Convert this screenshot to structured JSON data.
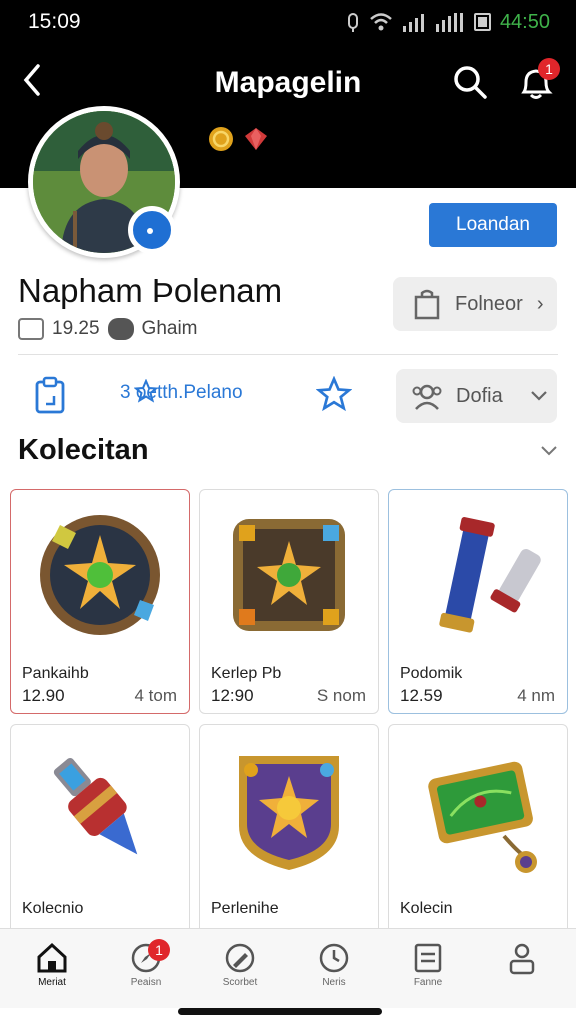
{
  "status": {
    "time": "15:09",
    "battery": "44:50"
  },
  "header": {
    "title": "Mapagelin",
    "glyph": " ",
    "notif_count": "1"
  },
  "profile": {
    "name": "Napham Þolenam",
    "stat_value": "19.25",
    "stat_label": "Ghaim",
    "primary_button": "Loandan",
    "follow_button": "Folneor"
  },
  "actions": {
    "middle_label": "3 oetth.Pelano",
    "dropdown_label": "Dofia"
  },
  "collection": {
    "title": "Kolecitan"
  },
  "cards": [
    {
      "name": "Pankaihb",
      "price": "12.90",
      "qty": "4 tom"
    },
    {
      "name": "Kerlep Pb",
      "price": "12:90",
      "qty": "S nom"
    },
    {
      "name": "Podomik",
      "price": "12.59",
      "qty": "4 nm"
    },
    {
      "name": "Kolecnio",
      "price": "",
      "qty": ""
    },
    {
      "name": "Perlenihe",
      "price": "",
      "qty": ""
    },
    {
      "name": "Kolecin",
      "price": "",
      "qty": ""
    }
  ],
  "nav": [
    {
      "label": "Meriat",
      "icon": "home-icon"
    },
    {
      "label": "Peaisn",
      "icon": "explore-icon"
    },
    {
      "label": "Scorbet",
      "icon": "edit-icon"
    },
    {
      "label": "Neris",
      "icon": "refresh-icon"
    },
    {
      "label": "Fanne",
      "icon": "list-icon"
    },
    {
      "label": "",
      "icon": "profile-icon"
    }
  ],
  "nav_badge": "1",
  "colors": {
    "accent": "#2a78d6",
    "badge": "#e0262b",
    "battery": "#3fb24a"
  }
}
